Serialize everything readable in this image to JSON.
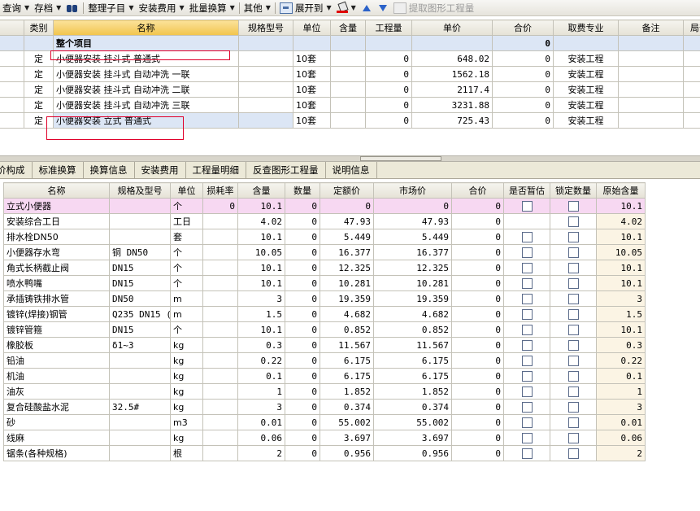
{
  "toolbar": {
    "query": "查询",
    "archive": "存档",
    "organize": "整理子目",
    "install_fee": "安装费用",
    "batch_convert": "批量换算",
    "other": "其他",
    "expand": "展开到",
    "extract": "提取图形工程量",
    "icons": [
      "binoculars-icon",
      "expand-icon",
      "paint-bucket-icon",
      "move-up-icon",
      "move-down-icon",
      "extract-icon"
    ]
  },
  "upper": {
    "columns": [
      "",
      "类别",
      "名称",
      "规格型号",
      "单位",
      "含量",
      "工程量",
      "单价",
      "合价",
      "取费专业",
      "备注",
      "局部"
    ],
    "summary_row": {
      "name": "整个项目",
      "total": "0"
    },
    "rows": [
      {
        "cat": "定",
        "name": "小便器安装 挂斗式 普通式",
        "spec": "",
        "unit": "10套",
        "content": "",
        "qty": "0",
        "price": "648.02",
        "total": "0",
        "major": "安装工程",
        "note": ""
      },
      {
        "cat": "定",
        "name": "小便器安装 挂斗式 自动冲洗 一联",
        "spec": "",
        "unit": "10套",
        "content": "",
        "qty": "0",
        "price": "1562.18",
        "total": "0",
        "major": "安装工程",
        "note": ""
      },
      {
        "cat": "定",
        "name": "小便器安装 挂斗式 自动冲洗 二联",
        "spec": "",
        "unit": "10套",
        "content": "",
        "qty": "0",
        "price": "2117.4",
        "total": "0",
        "major": "安装工程",
        "note": ""
      },
      {
        "cat": "定",
        "name": "小便器安装 挂斗式 自动冲洗 三联",
        "spec": "",
        "unit": "10套",
        "content": "",
        "qty": "0",
        "price": "3231.88",
        "total": "0",
        "major": "安装工程",
        "note": ""
      },
      {
        "cat": "定",
        "name": "小便器安装 立式 普通式",
        "spec": "",
        "unit": "10套",
        "content": "",
        "qty": "0",
        "price": "725.43",
        "total": "0",
        "major": "安装工程",
        "note": ""
      }
    ]
  },
  "tabs": [
    "价构成",
    "标准换算",
    "换算信息",
    "安装费用",
    "工程量明细",
    "反查图形工程量",
    "说明信息"
  ],
  "lower": {
    "columns": [
      "名称",
      "规格及型号",
      "单位",
      "损耗率",
      "含量",
      "数量",
      "定额价",
      "市场价",
      "合价",
      "是否暂估",
      "锁定数量",
      "原始含量"
    ],
    "rows": [
      {
        "name": "立式小便器",
        "spec": "",
        "unit": "个",
        "loss": "0",
        "content": "10.1",
        "qty": "0",
        "quota": "0",
        "market": "0",
        "total": "0",
        "orig": "10.1"
      },
      {
        "name": "安装综合工日",
        "spec": "",
        "unit": "工日",
        "loss": "",
        "content": "4.02",
        "qty": "0",
        "quota": "47.93",
        "market": "47.93",
        "total": "0",
        "orig": "4.02"
      },
      {
        "name": "排水栓DN50",
        "spec": "",
        "unit": "套",
        "loss": "",
        "content": "10.1",
        "qty": "0",
        "quota": "5.449",
        "market": "5.449",
        "total": "0",
        "orig": "10.1"
      },
      {
        "name": "小便器存水弯",
        "spec": "铜 DN50",
        "unit": "个",
        "loss": "",
        "content": "10.05",
        "qty": "0",
        "quota": "16.377",
        "market": "16.377",
        "total": "0",
        "orig": "10.05"
      },
      {
        "name": "角式长柄截止阀",
        "spec": "DN15",
        "unit": "个",
        "loss": "",
        "content": "10.1",
        "qty": "0",
        "quota": "12.325",
        "market": "12.325",
        "total": "0",
        "orig": "10.1"
      },
      {
        "name": "喷水鸭嘴",
        "spec": "DN15",
        "unit": "个",
        "loss": "",
        "content": "10.1",
        "qty": "0",
        "quota": "10.281",
        "market": "10.281",
        "total": "0",
        "orig": "10.1"
      },
      {
        "name": "承插铸铁排水管",
        "spec": "DN50",
        "unit": "m",
        "loss": "",
        "content": "3",
        "qty": "0",
        "quota": "19.359",
        "market": "19.359",
        "total": "0",
        "orig": "3"
      },
      {
        "name": "镀锌(焊接)钢管",
        "spec": "Q235 DN15 (",
        "unit": "m",
        "loss": "",
        "content": "1.5",
        "qty": "0",
        "quota": "4.682",
        "market": "4.682",
        "total": "0",
        "orig": "1.5"
      },
      {
        "name": "镀锌管箍",
        "spec": "DN15",
        "unit": "个",
        "loss": "",
        "content": "10.1",
        "qty": "0",
        "quota": "0.852",
        "market": "0.852",
        "total": "0",
        "orig": "10.1"
      },
      {
        "name": "橡胶板",
        "spec": "δ1~3",
        "unit": "kg",
        "loss": "",
        "content": "0.3",
        "qty": "0",
        "quota": "11.567",
        "market": "11.567",
        "total": "0",
        "orig": "0.3"
      },
      {
        "name": "铅油",
        "spec": "",
        "unit": "kg",
        "loss": "",
        "content": "0.22",
        "qty": "0",
        "quota": "6.175",
        "market": "6.175",
        "total": "0",
        "orig": "0.22"
      },
      {
        "name": "机油",
        "spec": "",
        "unit": "kg",
        "loss": "",
        "content": "0.1",
        "qty": "0",
        "quota": "6.175",
        "market": "6.175",
        "total": "0",
        "orig": "0.1"
      },
      {
        "name": "油灰",
        "spec": "",
        "unit": "kg",
        "loss": "",
        "content": "1",
        "qty": "0",
        "quota": "1.852",
        "market": "1.852",
        "total": "0",
        "orig": "1"
      },
      {
        "name": "复合硅酸盐水泥",
        "spec": "32.5#",
        "unit": "kg",
        "loss": "",
        "content": "3",
        "qty": "0",
        "quota": "0.374",
        "market": "0.374",
        "total": "0",
        "orig": "3"
      },
      {
        "name": "砂",
        "spec": "",
        "unit": "m3",
        "loss": "",
        "content": "0.01",
        "qty": "0",
        "quota": "55.002",
        "market": "55.002",
        "total": "0",
        "orig": "0.01"
      },
      {
        "name": "线麻",
        "spec": "",
        "unit": "kg",
        "loss": "",
        "content": "0.06",
        "qty": "0",
        "quota": "3.697",
        "market": "3.697",
        "total": "0",
        "orig": "0.06"
      },
      {
        "name": "锯条(各种规格)",
        "spec": "",
        "unit": "根",
        "loss": "",
        "content": "2",
        "qty": "0",
        "quota": "0.956",
        "market": "0.956",
        "total": "0",
        "orig": "2"
      }
    ]
  },
  "colors": {
    "header_highlight": "#f1c44c",
    "selected_row": "#dce6f5",
    "pink_row": "#f7d8f2",
    "annotation_box": "#e0002a"
  }
}
